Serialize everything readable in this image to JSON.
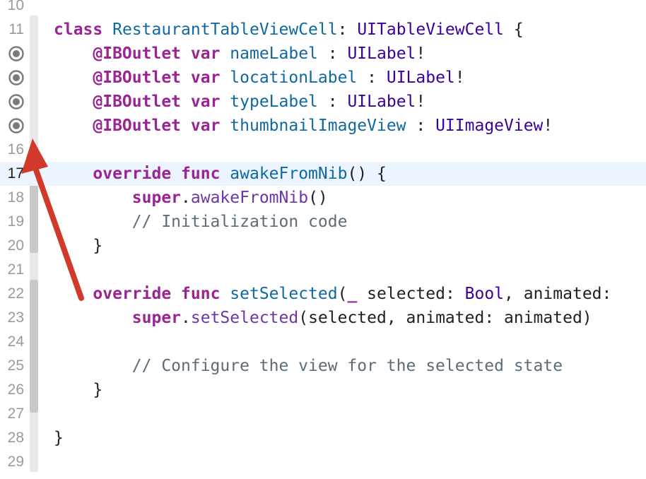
{
  "editor": {
    "lines": [
      {
        "num": "10",
        "segments": []
      },
      {
        "num": "11",
        "segments": [
          {
            "t": "class",
            "c": "kw"
          },
          {
            "t": " ",
            "c": ""
          },
          {
            "t": "RestaurantTableViewCell",
            "c": "decl"
          },
          {
            "t": ": ",
            "c": ""
          },
          {
            "t": "UITableViewCell",
            "c": "type"
          },
          {
            "t": " {",
            "c": ""
          }
        ]
      },
      {
        "num": "12",
        "outlet": true,
        "segments": [
          {
            "t": "    ",
            "c": ""
          },
          {
            "t": "@IBOutlet",
            "c": "kw"
          },
          {
            "t": " ",
            "c": ""
          },
          {
            "t": "var",
            "c": "kw"
          },
          {
            "t": " ",
            "c": ""
          },
          {
            "t": "nameLabel",
            "c": "decl"
          },
          {
            "t": " : ",
            "c": ""
          },
          {
            "t": "UILabel",
            "c": "type"
          },
          {
            "t": "!",
            "c": ""
          }
        ]
      },
      {
        "num": "13",
        "outlet": true,
        "segments": [
          {
            "t": "    ",
            "c": ""
          },
          {
            "t": "@IBOutlet",
            "c": "kw"
          },
          {
            "t": " ",
            "c": ""
          },
          {
            "t": "var",
            "c": "kw"
          },
          {
            "t": " ",
            "c": ""
          },
          {
            "t": "locationLabel",
            "c": "decl"
          },
          {
            "t": " : ",
            "c": ""
          },
          {
            "t": "UILabel",
            "c": "type"
          },
          {
            "t": "!",
            "c": ""
          }
        ]
      },
      {
        "num": "14",
        "outlet": true,
        "segments": [
          {
            "t": "    ",
            "c": ""
          },
          {
            "t": "@IBOutlet",
            "c": "kw"
          },
          {
            "t": " ",
            "c": ""
          },
          {
            "t": "var",
            "c": "kw"
          },
          {
            "t": " ",
            "c": ""
          },
          {
            "t": "typeLabel",
            "c": "decl"
          },
          {
            "t": " : ",
            "c": ""
          },
          {
            "t": "UILabel",
            "c": "type"
          },
          {
            "t": "!",
            "c": ""
          }
        ]
      },
      {
        "num": "15",
        "outlet": true,
        "segments": [
          {
            "t": "    ",
            "c": ""
          },
          {
            "t": "@IBOutlet",
            "c": "kw"
          },
          {
            "t": " ",
            "c": ""
          },
          {
            "t": "var",
            "c": "kw"
          },
          {
            "t": " ",
            "c": ""
          },
          {
            "t": "thumbnailImageView",
            "c": "decl"
          },
          {
            "t": " : ",
            "c": ""
          },
          {
            "t": "UIImageView",
            "c": "type"
          },
          {
            "t": "!",
            "c": ""
          }
        ]
      },
      {
        "num": "16",
        "segments": []
      },
      {
        "num": "17",
        "current": true,
        "segments": [
          {
            "t": "    ",
            "c": ""
          },
          {
            "t": "override",
            "c": "kw"
          },
          {
            "t": " ",
            "c": ""
          },
          {
            "t": "func",
            "c": "kw"
          },
          {
            "t": " ",
            "c": ""
          },
          {
            "t": "awakeFromNib",
            "c": "decl"
          },
          {
            "t": "() {",
            "c": ""
          }
        ]
      },
      {
        "num": "18",
        "segments": [
          {
            "t": "        ",
            "c": ""
          },
          {
            "t": "super",
            "c": "kw"
          },
          {
            "t": ".",
            "c": ""
          },
          {
            "t": "awakeFromNib",
            "c": "call"
          },
          {
            "t": "()",
            "c": ""
          }
        ]
      },
      {
        "num": "19",
        "segments": [
          {
            "t": "        ",
            "c": ""
          },
          {
            "t": "// Initialization code",
            "c": "com"
          }
        ]
      },
      {
        "num": "20",
        "segments": [
          {
            "t": "    }",
            "c": ""
          }
        ]
      },
      {
        "num": "21",
        "segments": []
      },
      {
        "num": "22",
        "segments": [
          {
            "t": "    ",
            "c": ""
          },
          {
            "t": "override",
            "c": "kw"
          },
          {
            "t": " ",
            "c": ""
          },
          {
            "t": "func",
            "c": "kw"
          },
          {
            "t": " ",
            "c": ""
          },
          {
            "t": "setSelected",
            "c": "decl"
          },
          {
            "t": "(",
            "c": ""
          },
          {
            "t": "_",
            "c": "kw"
          },
          {
            "t": " selected: ",
            "c": ""
          },
          {
            "t": "Bool",
            "c": "type"
          },
          {
            "t": ", animated: ",
            "c": ""
          }
        ]
      },
      {
        "num": "23",
        "segments": [
          {
            "t": "        ",
            "c": ""
          },
          {
            "t": "super",
            "c": "kw"
          },
          {
            "t": ".",
            "c": ""
          },
          {
            "t": "setSelected",
            "c": "call"
          },
          {
            "t": "(selected, animated: animated)",
            "c": ""
          }
        ]
      },
      {
        "num": "24",
        "segments": []
      },
      {
        "num": "25",
        "segments": [
          {
            "t": "        ",
            "c": ""
          },
          {
            "t": "// Configure the view for the selected state",
            "c": "com"
          }
        ]
      },
      {
        "num": "26",
        "segments": [
          {
            "t": "    }",
            "c": ""
          }
        ]
      },
      {
        "num": "27",
        "segments": []
      },
      {
        "num": "28",
        "segments": [
          {
            "t": "}",
            "c": ""
          }
        ]
      },
      {
        "num": "29",
        "segments": []
      }
    ]
  },
  "annotation": {
    "arrow_color": "#d13a2a",
    "arrow_icon": "red-arrow-icon"
  },
  "colors": {
    "keyword": "#9b2393",
    "type": "#3900a0",
    "declaration": "#0f68a0",
    "call": "#6c36a9",
    "comment": "#5d6c79",
    "current_line": "#ecf5ff"
  }
}
